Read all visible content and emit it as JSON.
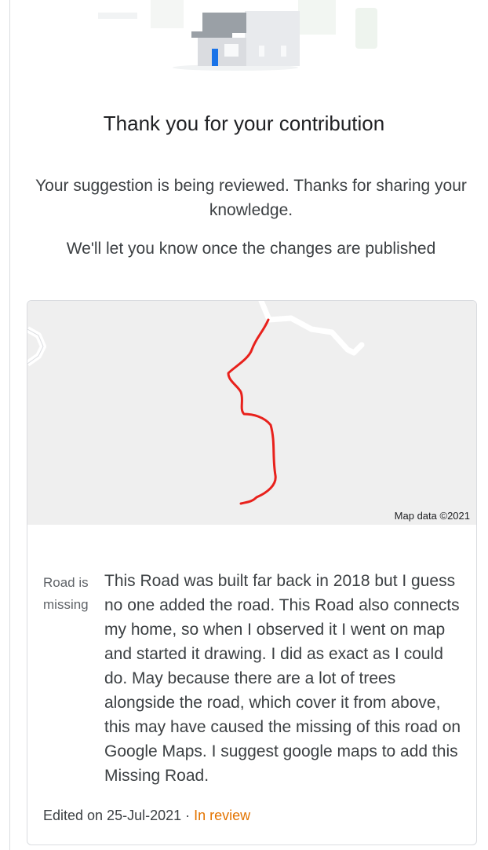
{
  "header": {
    "title": "Thank you for your contribution",
    "message_review": "Your suggestion is being reviewed. Thanks for sharing your knowledge.",
    "message_publish": "We'll let you know once the changes are published"
  },
  "contribution": {
    "map_attribution": "Map data ©2021",
    "category": "Road is missing",
    "description": "This Road was built far back in 2018 but I guess no one added the road. This Road also connects my home, so when I observed it I went on map and started it drawing. I did as exact as I could do. May because there are a lot of trees alongside the road, which cover it from above, this may have caused the missing of this road on Google Maps. I suggest google maps to add this Missing Road.",
    "edited_label": "Edited on 25-Jul-2021",
    "separator": " · ",
    "status": "In review"
  },
  "colors": {
    "drawn_road": "#e8211c",
    "status": "#e37400",
    "map_background": "#efefef",
    "house_door": "#1a73e8"
  },
  "icons": {
    "hero": "house-illustration"
  }
}
